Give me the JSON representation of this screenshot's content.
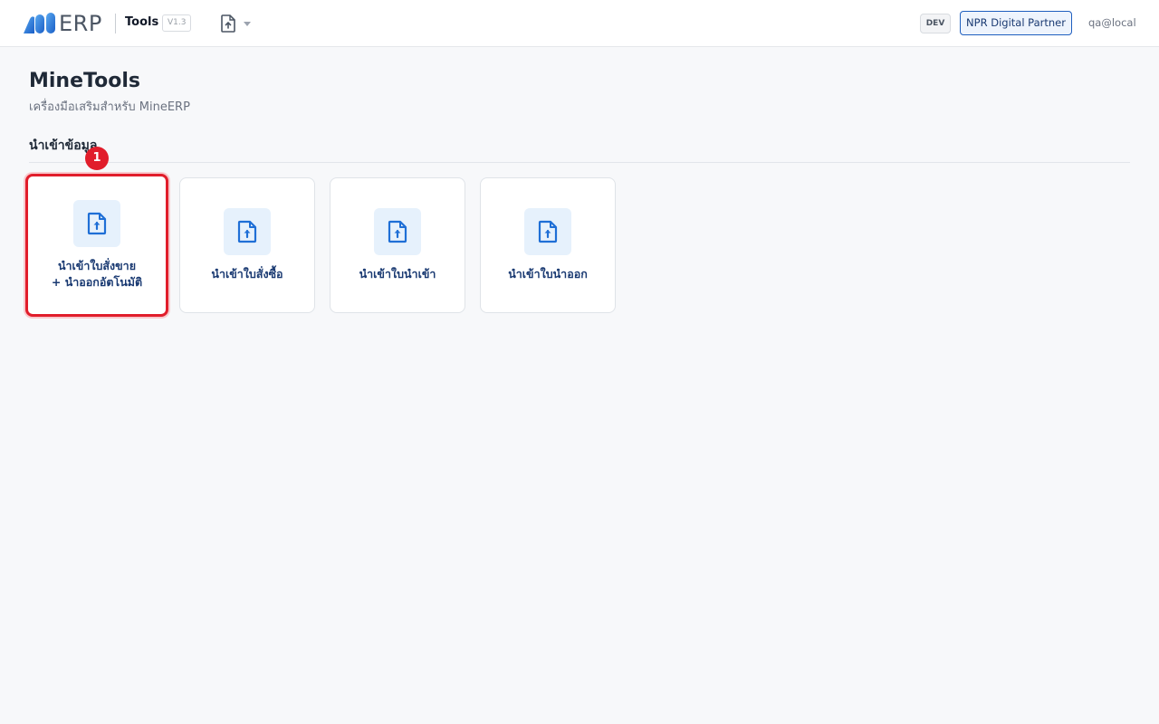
{
  "header": {
    "logo_text": "ERP",
    "app_name": "Tools",
    "version": "V1.3",
    "upload_menu_icon": "file-upload-icon",
    "environment": "DEV",
    "partner": "NPR Digital Partner",
    "user": "qa@local"
  },
  "page": {
    "title": "MineTools",
    "subtitle": "เครื่องมือเสริมสำหรับ MineERP"
  },
  "section": {
    "title": "นำเข้าข้อมูล"
  },
  "cards": [
    {
      "label": "นำเข้าใบสั่งขาย\n+ นำออกอัตโนมัติ",
      "icon": "file-upload-icon",
      "highlighted": true
    },
    {
      "label": "นำเข้าใบสั่งซื้อ",
      "icon": "file-upload-icon"
    },
    {
      "label": "นำเข้าใบนำเข้า",
      "icon": "file-upload-icon"
    },
    {
      "label": "นำเข้าใบนำออก",
      "icon": "file-upload-icon"
    }
  ],
  "annotation": {
    "step_number": "1"
  },
  "colors": {
    "brand_blue": "#1f6fd6",
    "highlight_red": "#e11d2b",
    "card_label": "#1a3a72"
  }
}
